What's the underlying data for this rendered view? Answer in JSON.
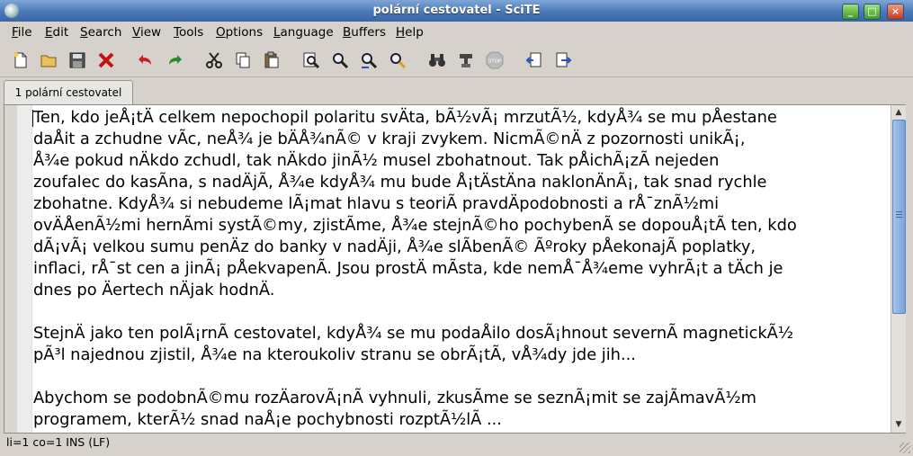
{
  "window": {
    "title": "polární cestovatel - SciTE"
  },
  "menu": [
    "File",
    "Edit",
    "Search",
    "View",
    "Tools",
    "Options",
    "Language",
    "Buffers",
    "Help"
  ],
  "toolbar": [
    "new-file-icon",
    "open-folder-icon",
    "save-disk-icon",
    "close-x-icon",
    "undo-icon",
    "redo-icon",
    "cut-scissors-icon",
    "copy-icon",
    "paste-icon",
    "find-icon",
    "find-next-icon",
    "replace-icon",
    "find-in-files-icon",
    "binoculars-icon",
    "compile-icon",
    "stop-icon",
    "prev-bookmark-icon",
    "next-bookmark-icon"
  ],
  "tab": {
    "label": "1 polární cestovatel"
  },
  "editor": {
    "lines": [
      "Ten, kdo jeÅ¡tÄ celkem nepochopil polaritu svÄta, bÃ½vÃ¡ mrzutÃ½, kdyÅ¾ se mu pÅestane",
      "daÅit a zchudne vÃ­c, neÅ¾ je bÄÅ¾nÃ© v kraji zvykem. NicmÃ©nÄ z pozornosti unikÃ¡,",
      "Å¾e pokud nÄkdo zchudl, tak nÄkdo jinÃ½ musel zbohatnout. Tak pÅichÃ¡zÃ­ nejeden",
      "zoufalec do kasÃ­na, s nadÄjÃ­, Å¾e kdyÅ¾ mu bude Å¡tÄstÄna naklonÄnÃ¡, tak snad rychle",
      "zbohatne. KdyÅ¾ si nebudeme lÃ¡mat hlavu s teoriÃ­ pravdÄpodobnosti a rÅ¯znÃ½mi",
      "ovÄÅenÃ½mi hernÃ­mi systÃ©my, zjistÃ­me, Å¾e stejnÃ©ho pochybenÃ­ se dopouÅ¡tÃ­ ten, kdo",
      "dÃ¡vÃ¡ velkou sumu penÄz do banky v nadÄji, Å¾e slÃ­benÃ© Ãºroky pÅekonajÃ­ poplatky,",
      "inflaci, rÅ¯st cen a jinÃ¡ pÅekvapenÃ­. Jsou prostÄ mÃ­sta, kde nemÅ¯Å¾eme vyhrÃ¡t a tÄch je",
      "dnes po Äertech nÄjak hodnÄ.",
      "",
      "StejnÄ jako ten polÃ¡rnÃ­ cestovatel, kdyÅ¾ se mu podaÅilo dosÃ¡hnout severnÃ­ magnetickÃ½",
      "pÃ³l najednou zjistil, Å¾e na kteroukoliv stranu se obrÃ¡tÃ­, vÅ¾dy jde jih...",
      "",
      "Abychom se podobnÃ©mu rozÄarovÃ¡nÃ­ vyhnuli, zkusÃ­me se seznÃ¡mit se zajÃ­mavÃ½m",
      "programem, kterÃ½ snad naÅ¡e pochybnosti rozptÃ½lÃ­ ..."
    ]
  },
  "status": {
    "text": "li=1 co=1 INS (LF)"
  }
}
